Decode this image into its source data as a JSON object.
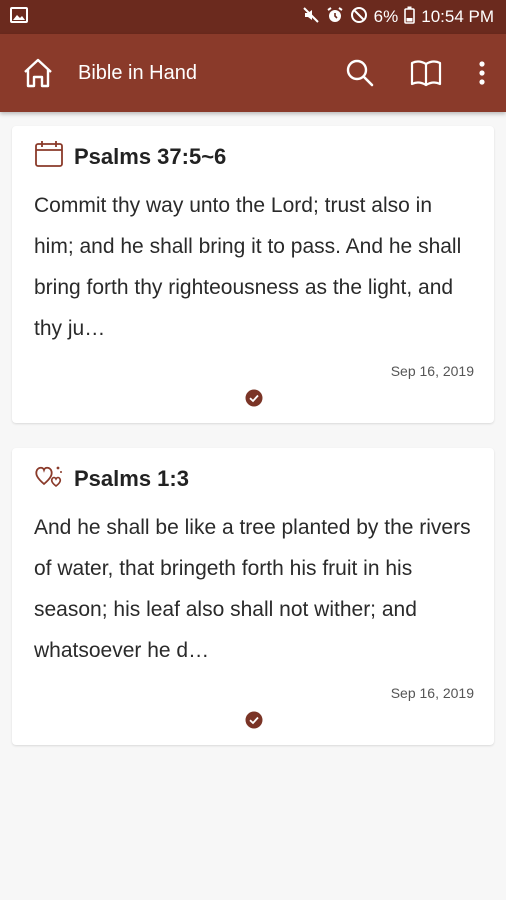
{
  "status": {
    "battery": "6%",
    "time": "10:54 PM"
  },
  "app": {
    "title": "Bible in Hand"
  },
  "cards": [
    {
      "reference": "Psalms 37:5~6",
      "icon": "calendar-icon",
      "text": "Commit thy way unto the Lord; trust also in him; and he shall bring it to pass.  And he shall bring forth thy righteousness as the light, and thy ju…",
      "date": "Sep 16, 2019"
    },
    {
      "reference": "Psalms 1:3",
      "icon": "hearts-icon",
      "text": "And he shall be like a tree planted by the rivers of water, that bringeth forth his fruit in his season; his leaf also shall not wither; and whatsoever he d…",
      "date": "Sep 16, 2019"
    }
  ],
  "colors": {
    "statusbar": "#6b2a1e",
    "appbar": "#8a3a2a",
    "accent": "#7a3426",
    "background": "#f7f7f7"
  }
}
